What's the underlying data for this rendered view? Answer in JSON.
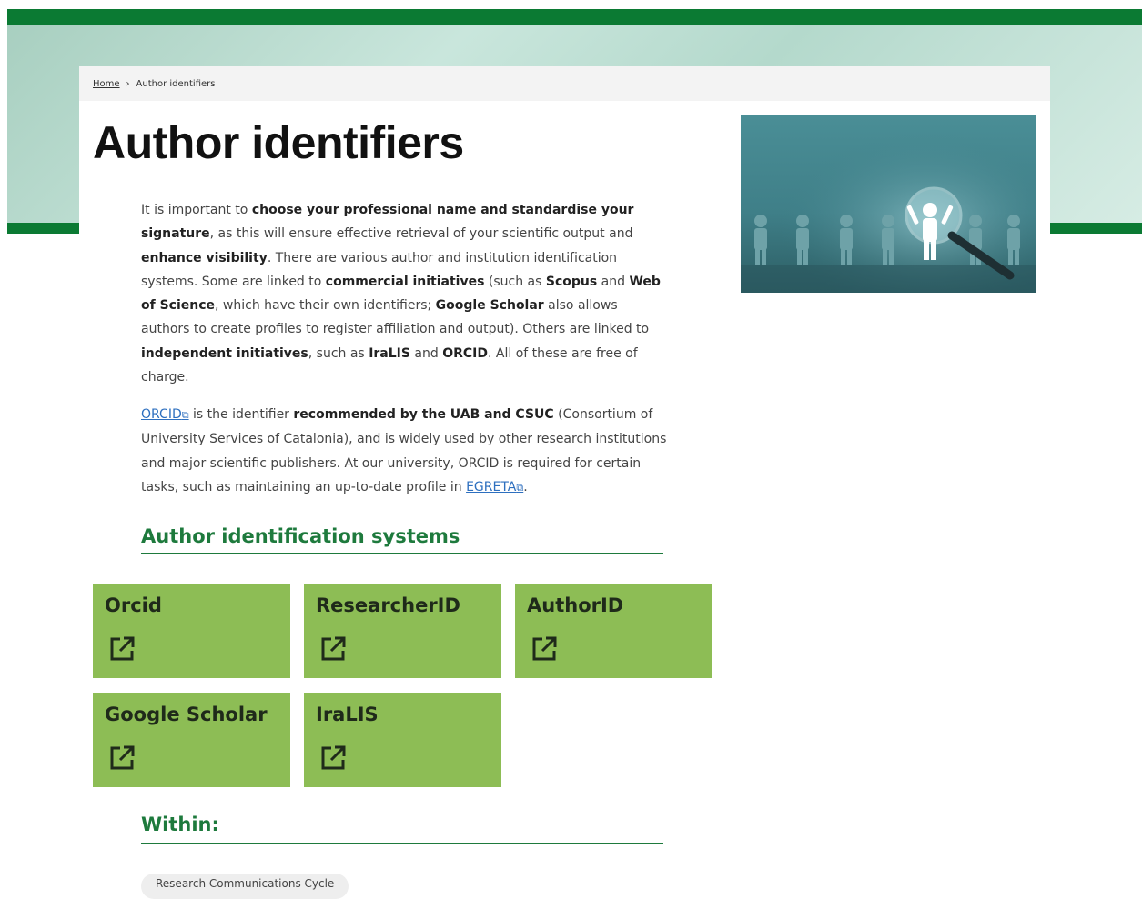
{
  "breadcrumb": {
    "home": "Home",
    "separator": "›",
    "current": "Author identifiers"
  },
  "page_title": "Author identifiers",
  "intro": {
    "t1": "It is important to ",
    "b1": "choose your professional name and standardise your signature",
    "t2": ", as this will ensure effective retrieval of your scientific output and ",
    "b2": "enhance visibility",
    "t3": ". There are various author and institution identification systems. Some are linked to ",
    "b3": "commercial initiatives",
    "t4": " (such as ",
    "b4": "Scopus",
    "t5": " and ",
    "b5": "Web of Science",
    "t6": ", which have their own identifiers; ",
    "b6": "Google Scholar",
    "t7": " also allows authors to create profiles to register affiliation and output). Others are linked to ",
    "b7": "independent initiatives",
    "t8": ", such as ",
    "b8": "IraLIS",
    "t9": " and ",
    "b9": "ORCID",
    "t10": ". All of these are free of charge."
  },
  "orcid_paragraph": {
    "link1": "ORCID",
    "t1": " is the identifier ",
    "b1": "recommended by the UAB and CSUC",
    "t2": " (Consortium of University Services of Catalonia), and is widely used by other research institutions and major scientific publishers. At our university, ORCID is required for certain tasks, such as maintaining an up-to-date profile in ",
    "link2": "EGRETA",
    "t3": "."
  },
  "systems_heading": "Author identification systems",
  "cards": [
    {
      "label": "Orcid"
    },
    {
      "label": "ResearcherID"
    },
    {
      "label": "AuthorID"
    },
    {
      "label": "Google Scholar"
    },
    {
      "label": "IraLIS"
    }
  ],
  "within_heading": "Within:",
  "tag": "Research Communications Cycle",
  "colors": {
    "brand_green": "#0b7a33",
    "heading_green": "#1e7a3d",
    "card_green": "#8dbd55",
    "link_blue": "#2d6fbf"
  },
  "icons": {
    "card_icon": "external-link-icon",
    "inline_link_icon": "external-link-icon"
  }
}
